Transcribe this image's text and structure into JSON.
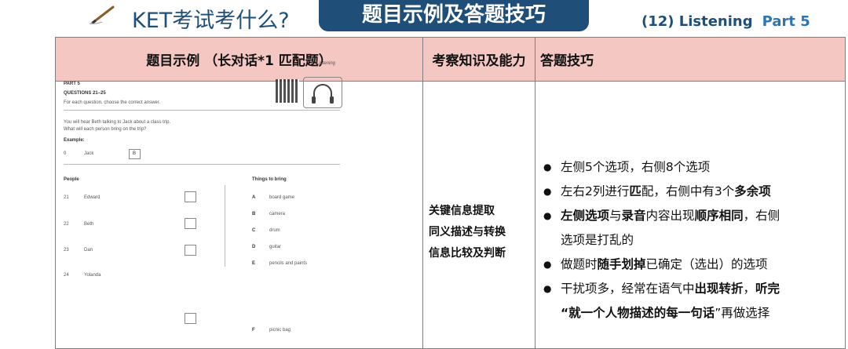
{
  "header": {
    "slide_title": "KET考试考什么?",
    "badge": "题目示例及答题技巧",
    "section": "(12) Listening",
    "part": "Part 5"
  },
  "table": {
    "headers": [
      "题目示例 （长对话*1 匹配题）",
      "考察知识及能力",
      "答题技巧"
    ],
    "skills": [
      "关键信息提取",
      "同义描述与转换",
      "信息比较及判断"
    ],
    "tips": [
      {
        "parts": [
          {
            "t": "左侧5个选项，右侧8个选项",
            "b": false
          }
        ]
      },
      {
        "parts": [
          {
            "t": "左右2列进行",
            "b": false
          },
          {
            "t": "匹",
            "b": true
          },
          {
            "t": "配，右侧中有3个",
            "b": false
          },
          {
            "t": "多余项",
            "b": true
          }
        ]
      },
      {
        "parts": [
          {
            "t": "左侧选项",
            "b": true
          },
          {
            "t": "与",
            "b": false
          },
          {
            "t": "录音",
            "b": true
          },
          {
            "t": "内容出现",
            "b": false
          },
          {
            "t": "顺序相同",
            "b": true
          },
          {
            "t": "，右侧",
            "b": false
          }
        ]
      },
      {
        "cont": true,
        "parts": [
          {
            "t": "选项是打乱的",
            "b": false
          }
        ]
      },
      {
        "parts": [
          {
            "t": "做题时",
            "b": false
          },
          {
            "t": "随手划掉",
            "b": true
          },
          {
            "t": "已确定（选出）的选项",
            "b": false
          }
        ]
      },
      {
        "parts": [
          {
            "t": "干扰项多，经常在语气中",
            "b": false
          },
          {
            "t": "出现转折",
            "b": true
          },
          {
            "t": "，",
            "b": false
          },
          {
            "t": "听完",
            "b": true
          }
        ]
      },
      {
        "cont": true,
        "parts": [
          {
            "t": "“就一个人物描述的每一句话",
            "b": true
          },
          {
            "t": "”再做选择",
            "b": false
          }
        ]
      }
    ]
  },
  "paper": {
    "header_right": "Listening",
    "part": "PART 5",
    "questions": "QUESTIONS 21–25",
    "instruction": "For each question, choose the correct answer.",
    "intro1": "You will hear Beth talking to Jack about a class trip.",
    "intro2": "What will each person bring on the trip?",
    "example_label": "Example:",
    "example_num": "0",
    "example_name": "Jack",
    "example_answer": "B",
    "people_header": "People",
    "things_header": "Things to bring",
    "people": [
      {
        "num": "21",
        "name": "Edward"
      },
      {
        "num": "22",
        "name": "Beth"
      },
      {
        "num": "23",
        "name": "Dan"
      },
      {
        "num": "24",
        "name": "Yolanda"
      }
    ],
    "things": [
      {
        "letter": "A",
        "item": "board game"
      },
      {
        "letter": "B",
        "item": "camera"
      },
      {
        "letter": "C",
        "item": "drum"
      },
      {
        "letter": "D",
        "item": "guitar"
      },
      {
        "letter": "E",
        "item": "pencils and paints"
      },
      {
        "letter": "F",
        "item": "picnic bag"
      }
    ]
  }
}
